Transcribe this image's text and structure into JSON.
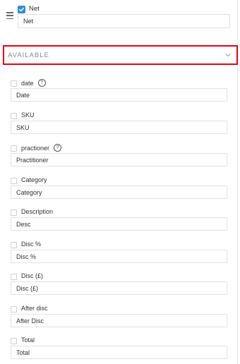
{
  "selected_field": {
    "label": "Net",
    "value": "Net",
    "checked": true,
    "icon": "check-icon"
  },
  "available": {
    "title": "AVAILABLE",
    "icon": "chevron-down-icon"
  },
  "fields": [
    {
      "label": "date",
      "value": "Date",
      "help": true
    },
    {
      "label": "SKU",
      "value": "SKU",
      "help": false
    },
    {
      "label": "practioner",
      "value": "Practitioner",
      "help": true
    },
    {
      "label": "Category",
      "value": "Category",
      "help": false
    },
    {
      "label": "Description",
      "value": "Desc",
      "help": false
    },
    {
      "label": "Disc %",
      "value": "Disc %",
      "help": false
    },
    {
      "label": "Disc (£)",
      "value": "Disc (£)",
      "help": false
    },
    {
      "label": "After disc",
      "value": "After Disc",
      "help": false
    },
    {
      "label": "Total",
      "value": "Total",
      "help": false
    }
  ],
  "help_glyph": "?",
  "colors": {
    "accent": "#2f8fd0",
    "highlight": "#e3001b"
  }
}
